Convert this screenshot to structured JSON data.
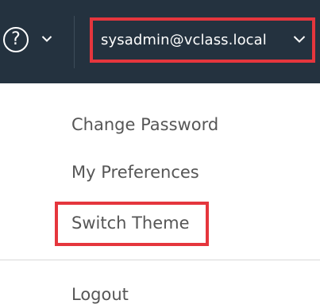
{
  "header": {
    "help_icon": "question-circle-icon",
    "help_chevron_icon": "chevron-down-icon",
    "user_label": "sysadmin@vclass.local",
    "user_chevron_icon": "chevron-down-icon",
    "highlight_color": "#e5363d",
    "background_color": "#24323f"
  },
  "menu": {
    "items": [
      {
        "label": "Change Password"
      },
      {
        "label": "My Preferences"
      },
      {
        "label": "Switch Theme"
      },
      {
        "label": "Logout"
      }
    ]
  }
}
